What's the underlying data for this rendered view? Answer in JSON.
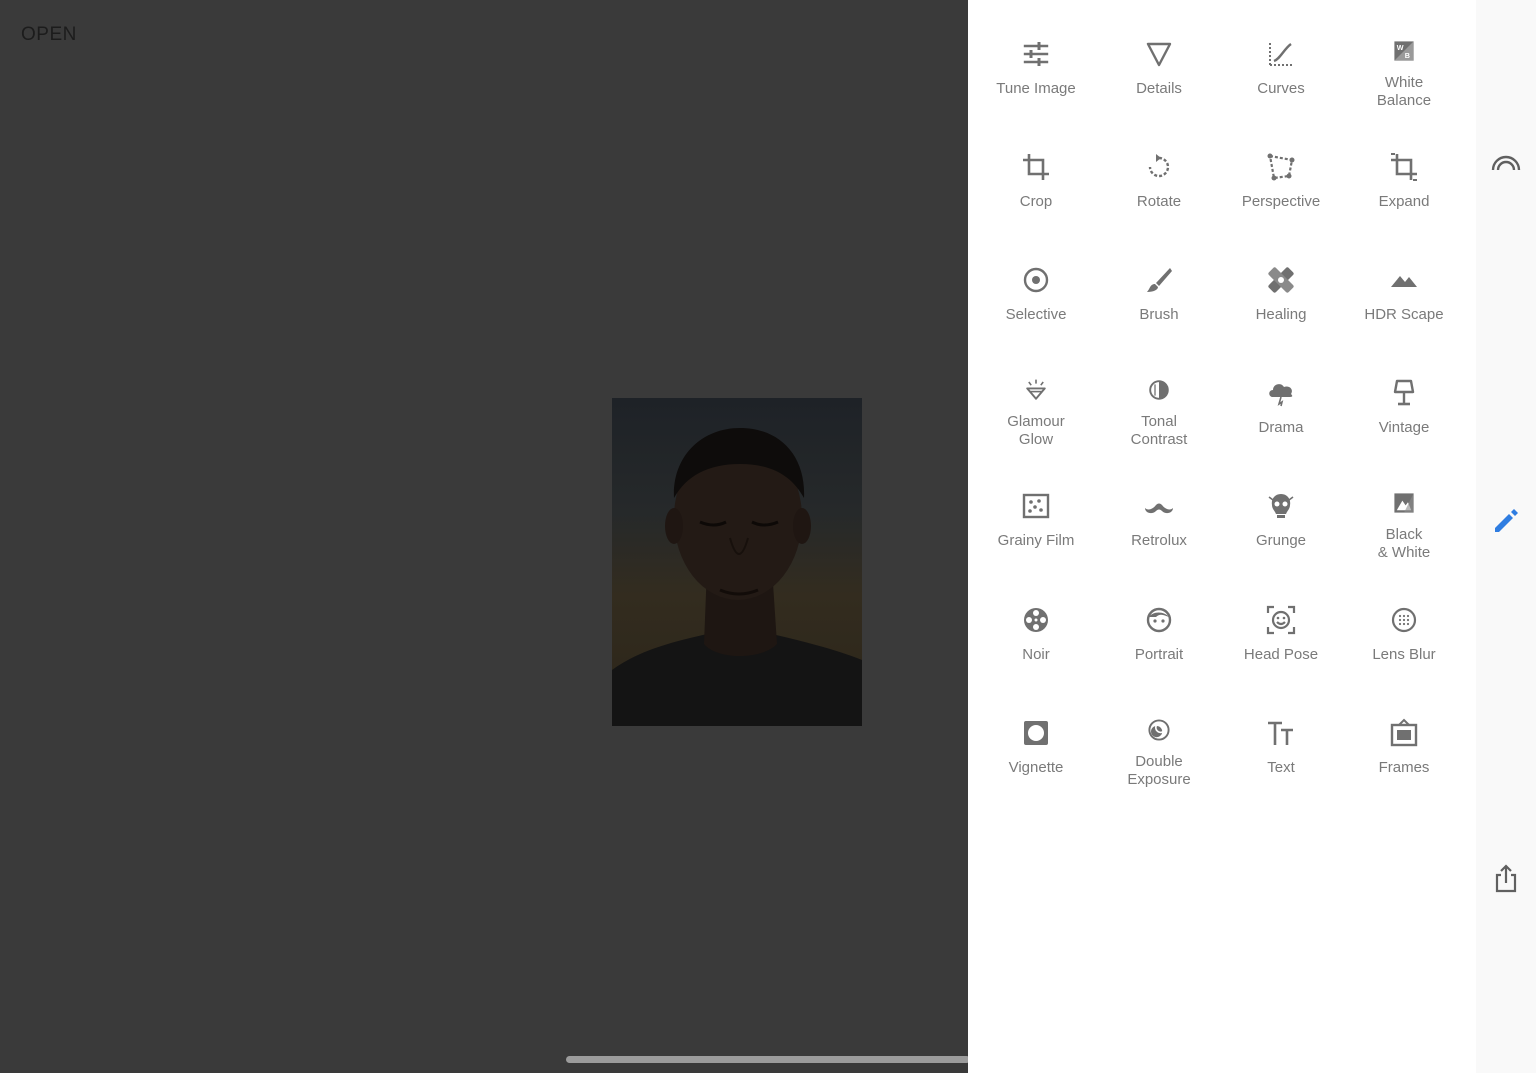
{
  "canvas": {
    "open_label": "OPEN"
  },
  "tools": [
    {
      "label": "Tune Image",
      "icon": "tune-image-icon"
    },
    {
      "label": "Details",
      "icon": "details-icon"
    },
    {
      "label": "Curves",
      "icon": "curves-icon"
    },
    {
      "label": "White\nBalance",
      "icon": "white-balance-icon"
    },
    {
      "label": "Crop",
      "icon": "crop-icon"
    },
    {
      "label": "Rotate",
      "icon": "rotate-icon"
    },
    {
      "label": "Perspective",
      "icon": "perspective-icon"
    },
    {
      "label": "Expand",
      "icon": "expand-icon"
    },
    {
      "label": "Selective",
      "icon": "selective-icon"
    },
    {
      "label": "Brush",
      "icon": "brush-icon"
    },
    {
      "label": "Healing",
      "icon": "healing-icon"
    },
    {
      "label": "HDR Scape",
      "icon": "hdr-scape-icon"
    },
    {
      "label": "Glamour\nGlow",
      "icon": "glamour-glow-icon"
    },
    {
      "label": "Tonal\nContrast",
      "icon": "tonal-contrast-icon"
    },
    {
      "label": "Drama",
      "icon": "drama-icon"
    },
    {
      "label": "Vintage",
      "icon": "vintage-icon"
    },
    {
      "label": "Grainy Film",
      "icon": "grainy-film-icon"
    },
    {
      "label": "Retrolux",
      "icon": "retrolux-icon"
    },
    {
      "label": "Grunge",
      "icon": "grunge-icon"
    },
    {
      "label": "Black\n& White",
      "icon": "black-white-icon"
    },
    {
      "label": "Noir",
      "icon": "noir-icon"
    },
    {
      "label": "Portrait",
      "icon": "portrait-icon"
    },
    {
      "label": "Head Pose",
      "icon": "head-pose-icon"
    },
    {
      "label": "Lens Blur",
      "icon": "lens-blur-icon"
    },
    {
      "label": "Vignette",
      "icon": "vignette-icon"
    },
    {
      "label": "Double\nExposure",
      "icon": "double-exposure-icon"
    },
    {
      "label": "Text",
      "icon": "text-icon"
    },
    {
      "label": "Frames",
      "icon": "frames-icon"
    }
  ],
  "rail": {
    "looks_icon": "looks-icon",
    "tools_icon": "pencil-icon",
    "export_icon": "share-icon"
  },
  "colors": {
    "accent": "#2f7de1",
    "icon_gray": "#707070",
    "label_gray": "#7a7a7a"
  }
}
